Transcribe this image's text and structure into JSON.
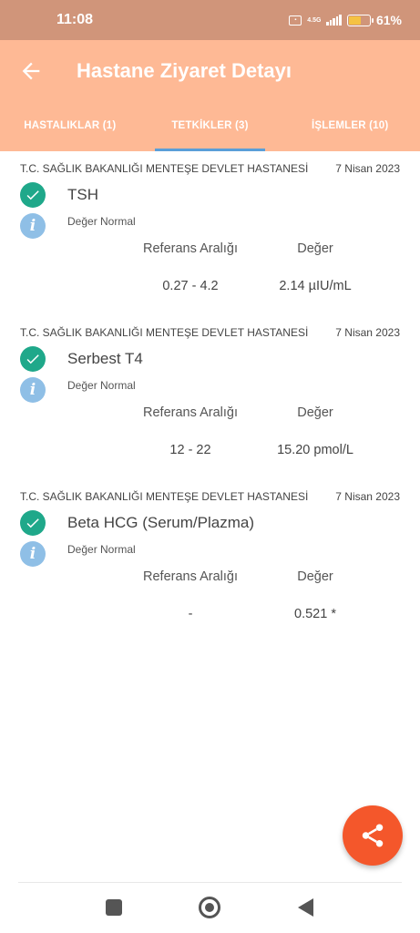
{
  "status_bar": {
    "time": "11:08",
    "network_label": "VoLTE",
    "network_type": "4.5G",
    "battery": "61%",
    "battery_level": 0.61
  },
  "header": {
    "title": "Hastane Ziyaret Detayı",
    "tabs": [
      {
        "label": "HASTALIKLAR (1)",
        "active": false
      },
      {
        "label": "TETKİKLER (3)",
        "active": true
      },
      {
        "label": "İŞLEMLER (10)",
        "active": false
      }
    ]
  },
  "columns": {
    "reference": "Referans Aralığı",
    "value": "Değer"
  },
  "tests": [
    {
      "hospital": "T.C. SAĞLIK BAKANLIĞI MENTEŞE DEVLET HASTANESİ",
      "date": "7 Nisan 2023",
      "name": "TSH",
      "status": "Değer Normal",
      "reference": "0.27 - 4.2",
      "value": "2.14 µIU/mL"
    },
    {
      "hospital": "T.C. SAĞLIK BAKANLIĞI MENTEŞE DEVLET HASTANESİ",
      "date": "7 Nisan 2023",
      "name": "Serbest T4",
      "status": "Değer Normal",
      "reference": "12 - 22",
      "value": "15.20 pmol/L"
    },
    {
      "hospital": "T.C. SAĞLIK BAKANLIĞI MENTEŞE DEVLET HASTANESİ",
      "date": "7 Nisan 2023",
      "name": "Beta HCG (Serum/Plazma)",
      "status": "Değer Normal",
      "reference": "-",
      "value": "0.521 *"
    }
  ],
  "colors": {
    "status_bar": "#d0957a",
    "app_bar": "#feb995",
    "tab_indicator": "#5a9fd8",
    "check": "#1fa88a",
    "info": "#8fbfe6",
    "fab": "#f4572b"
  },
  "icons": {
    "back": "arrow-left-icon",
    "check": "check-circle-icon",
    "info": "info-icon",
    "fab": "share-icon"
  }
}
